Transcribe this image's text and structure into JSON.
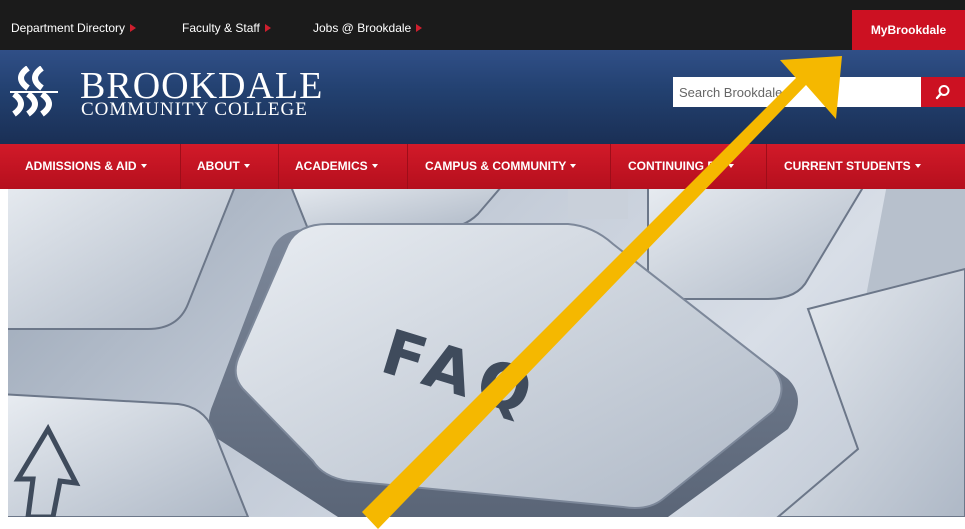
{
  "topbar": {
    "links": [
      {
        "label": "Department Directory"
      },
      {
        "label": "Faculty & Staff"
      },
      {
        "label": "Jobs @ Brookdale"
      }
    ],
    "my_button": "MyBrookdale"
  },
  "logo": {
    "name": "BROOKDALE",
    "sub": "COMMUNITY COLLEGE"
  },
  "search": {
    "placeholder": "Search Brookdale"
  },
  "nav": {
    "items": [
      {
        "label": "ADMISSIONS & AID"
      },
      {
        "label": "ABOUT"
      },
      {
        "label": "ACADEMICS"
      },
      {
        "label": "CAMPUS & COMMUNITY"
      },
      {
        "label": "CONTINUING ED"
      },
      {
        "label": "CURRENT STUDENTS"
      }
    ]
  },
  "hero": {
    "key_label": "FAQ"
  },
  "colors": {
    "brand_red": "#cc1122",
    "header_blue": "#22406f",
    "topbar_dark": "#1b1b1b",
    "annotation_arrow": "#f5b800"
  }
}
